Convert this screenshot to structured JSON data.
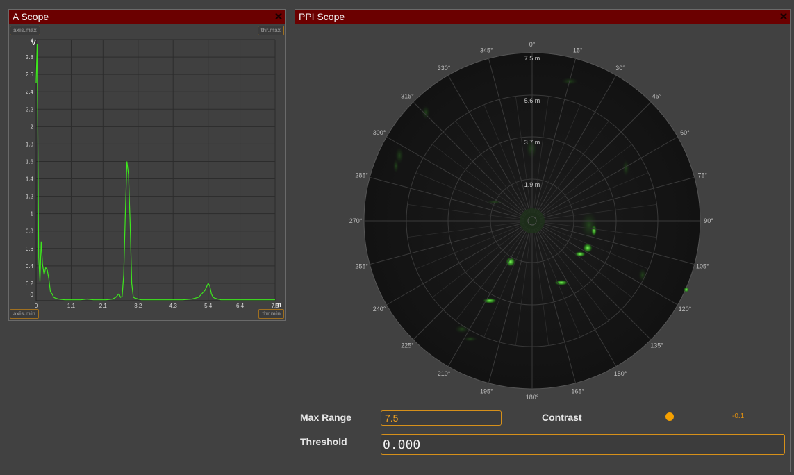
{
  "ascope": {
    "title": "A Scope",
    "close_glyph": "✕",
    "tag_axis_max": "axis.max",
    "tag_thr_max": "thr.max",
    "tag_axis_min": "axis.min",
    "tag_thr_min": "thr.min",
    "y_unit": "V",
    "x_unit": "m",
    "y_ticks": [
      "3",
      "2.8",
      "2.6",
      "2.4",
      "2.2",
      "2",
      "1.8",
      "1.6",
      "1.4",
      "1.2",
      "1",
      "0.8",
      "0.6",
      "0.4",
      "0.2",
      "0"
    ],
    "x_ticks": [
      "0",
      "1.1",
      "2.1",
      "3.2",
      "4.3",
      "5.4",
      "6.4",
      "7.5"
    ],
    "trace_color": "#3ee61e"
  },
  "chart_data": {
    "type": "line",
    "xlabel": "m",
    "ylabel": "V",
    "xlim": [
      0,
      7.5
    ],
    "ylim": [
      0,
      3
    ],
    "grid": true,
    "series": [
      {
        "x": [
          0,
          0.03,
          0.05,
          0.08,
          0.12,
          0.16,
          0.2,
          0.25,
          0.3,
          0.35,
          0.4,
          0.45,
          0.5,
          0.55,
          0.6,
          0.7,
          0.8,
          0.9,
          1.0,
          1.2,
          1.4,
          1.6,
          1.8,
          2.0,
          2.2,
          2.4,
          2.5,
          2.6,
          2.65,
          2.7,
          2.75,
          2.8,
          2.85,
          2.9,
          2.95,
          3.0,
          3.05,
          3.1,
          3.2,
          3.3,
          3.4,
          3.6,
          3.8,
          4.0,
          4.3,
          4.6,
          4.9,
          5.1,
          5.2,
          5.3,
          5.4,
          5.45,
          5.5,
          5.55,
          5.6,
          5.7,
          5.8,
          6.0,
          6.2,
          6.4,
          6.6,
          6.8,
          7.0,
          7.2,
          7.5
        ],
        "y": [
          2.5,
          2.95,
          2.1,
          0.5,
          0.22,
          0.68,
          0.42,
          0.3,
          0.38,
          0.35,
          0.25,
          0.1,
          0.08,
          0.04,
          0.03,
          0.02,
          0.015,
          0.01,
          0.01,
          0.01,
          0.01,
          0.02,
          0.01,
          0.01,
          0.01,
          0.02,
          0.04,
          0.08,
          0.04,
          0.05,
          0.3,
          1.0,
          1.6,
          1.45,
          0.9,
          0.2,
          0.04,
          0.03,
          0.02,
          0.01,
          0.01,
          0.01,
          0.01,
          0.01,
          0.01,
          0.01,
          0.02,
          0.04,
          0.08,
          0.12,
          0.2,
          0.17,
          0.08,
          0.04,
          0.03,
          0.02,
          0.01,
          0.01,
          0.01,
          0.01,
          0.01,
          0.01,
          0.01,
          0.01,
          0.01
        ]
      }
    ]
  },
  "ppi": {
    "title": "PPI Scope",
    "close_glyph": "✕",
    "range_labels": [
      "7.5 m",
      "5.6 m",
      "3.7 m",
      "1.9 m"
    ],
    "angle_labels": [
      "0°",
      "15°",
      "30°",
      "45°",
      "60°",
      "75°",
      "90°",
      "105°",
      "120°",
      "135°",
      "150°",
      "165°",
      "180°",
      "195°",
      "210°",
      "225°",
      "240°",
      "255°",
      "270°",
      "285°",
      "300°",
      "315°",
      "330°",
      "345°"
    ]
  },
  "controls": {
    "max_range_label": "Max Range",
    "max_range_value": "7.5",
    "contrast_label": "Contrast",
    "contrast_value": "-0.1",
    "contrast_fraction": 0.45,
    "threshold_label": "Threshold",
    "threshold_value": "0.000"
  },
  "colors": {
    "title_bar": "#6b0000",
    "accent": "#f5a000",
    "background": "#414141"
  }
}
